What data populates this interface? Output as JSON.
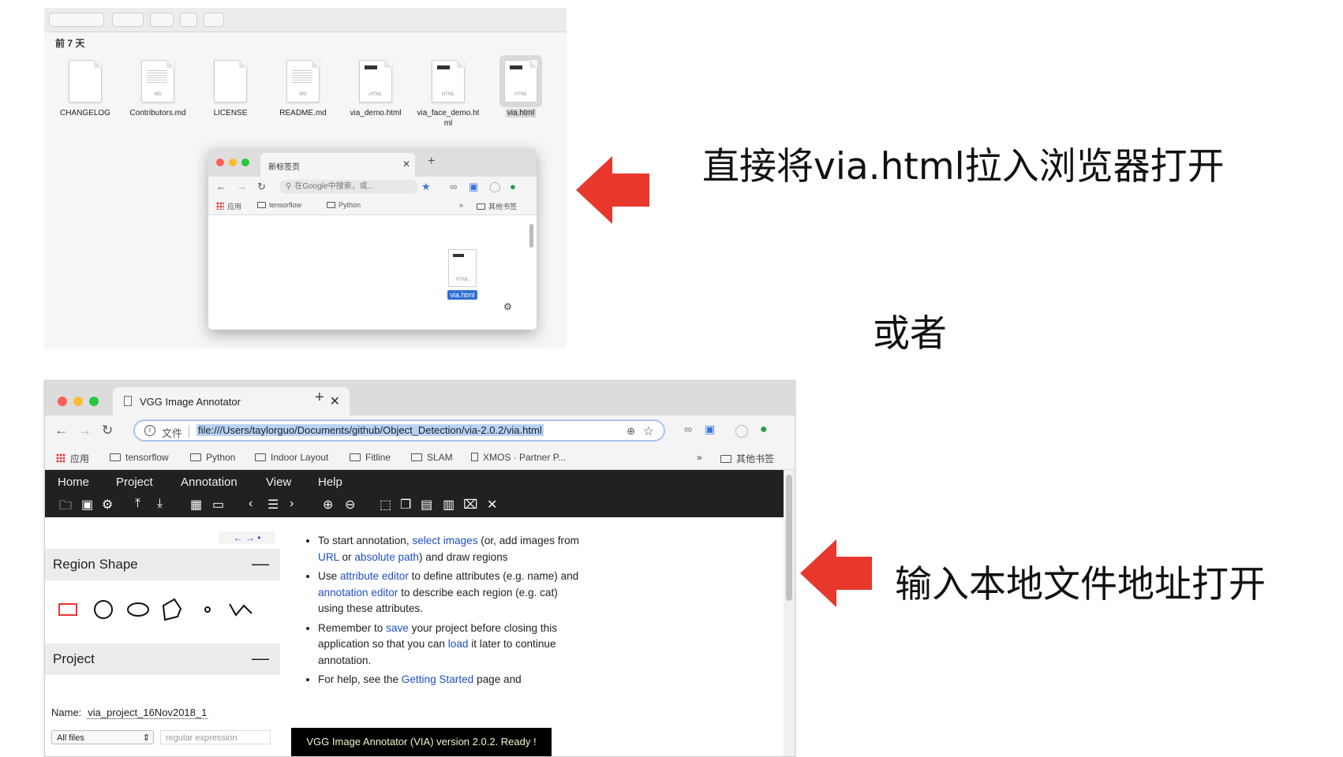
{
  "finder": {
    "section_label": "前 7 天",
    "files": [
      {
        "name": "CHANGELOG",
        "type": ""
      },
      {
        "name": "Contributors.md",
        "type": "MD"
      },
      {
        "name": "LICENSE",
        "type": ""
      },
      {
        "name": "README.md",
        "type": "MD"
      },
      {
        "name": "via_demo.html",
        "type": "HTML"
      },
      {
        "name": "via_face_demo.ht ml",
        "type": "HTML"
      },
      {
        "name": "via.html",
        "type": "HTML",
        "selected": true
      }
    ],
    "mini_browser": {
      "tab_title": "新标签页",
      "omnibox_placeholder": "在Google中搜索，或...",
      "bookmarks": [
        "应用",
        "tensorflow",
        "Python",
        "»",
        "其他书签"
      ],
      "dragged_file": "via.html",
      "dragged_file_type": "HTML"
    }
  },
  "captions": {
    "top": "直接将via.html拉入浏览器打开",
    "middle": "或者",
    "bottom": "输入本地文件地址打开"
  },
  "colors": {
    "arrow": "#e8372c",
    "menu_bg": "#212121",
    "link": "#1f4fc4"
  },
  "chrome": {
    "tab_title": "VGG Image Annotator",
    "omnibox_label": "文件",
    "url": "file:///Users/taylorguo/Documents/github/Object_Detection/via-2.0.2/via.html",
    "bookmarks": [
      "应用",
      "tensorflow",
      "Python",
      "Indoor Layout",
      "Fitline",
      "SLAM",
      "XMOS · Partner P...",
      "»",
      "其他书签"
    ]
  },
  "via": {
    "menu": [
      "Home",
      "Project",
      "Annotation",
      "View",
      "Help"
    ],
    "toolbar_icons": [
      "open-folder-icon",
      "save-icon",
      "settings-icon",
      "upload-icon",
      "download-icon",
      "grid-icon",
      "comment-icon",
      "prev-icon",
      "list-icon",
      "next-icon",
      "zoom-in-icon",
      "zoom-out-icon",
      "select-all-icon",
      "copy-icon",
      "paste-icon",
      "paste-special-icon",
      "delete-icon",
      "close-icon"
    ],
    "nav_links": "← → •",
    "region_shape_title": "Region Shape",
    "project_title": "Project",
    "collapse_symbol": "—",
    "project_name_label": "Name:",
    "project_name": "via_project_16Nov2018_1",
    "filter_select": "All files",
    "regex_placeholder": "regular expression",
    "help": {
      "b1_pre": "To start annotation,",
      "b1_link1": "select images",
      "b1_mid1": "(or, add images from",
      "b1_link2": "URL",
      "b1_mid2": "or",
      "b1_link3": "absolute path",
      "b1_post": ") and draw regions",
      "b2_pre": "Use",
      "b2_link1": "attribute editor",
      "b2_mid": "to define attributes (e.g. name) and",
      "b2_link2": "annotation editor",
      "b2_post": "to describe each region (e.g. cat) using these attributes.",
      "b3_pre": "Remember to",
      "b3_link1": "save",
      "b3_mid": "your project before closing this application so that you can",
      "b3_link2": "load",
      "b3_post": "it later to continue annotation.",
      "b4_pre": "For help, see the",
      "b4_link1": "Getting Started",
      "b4_post": "page and"
    },
    "status": "VGG Image Annotator (VIA) version 2.0.2. Ready !"
  }
}
